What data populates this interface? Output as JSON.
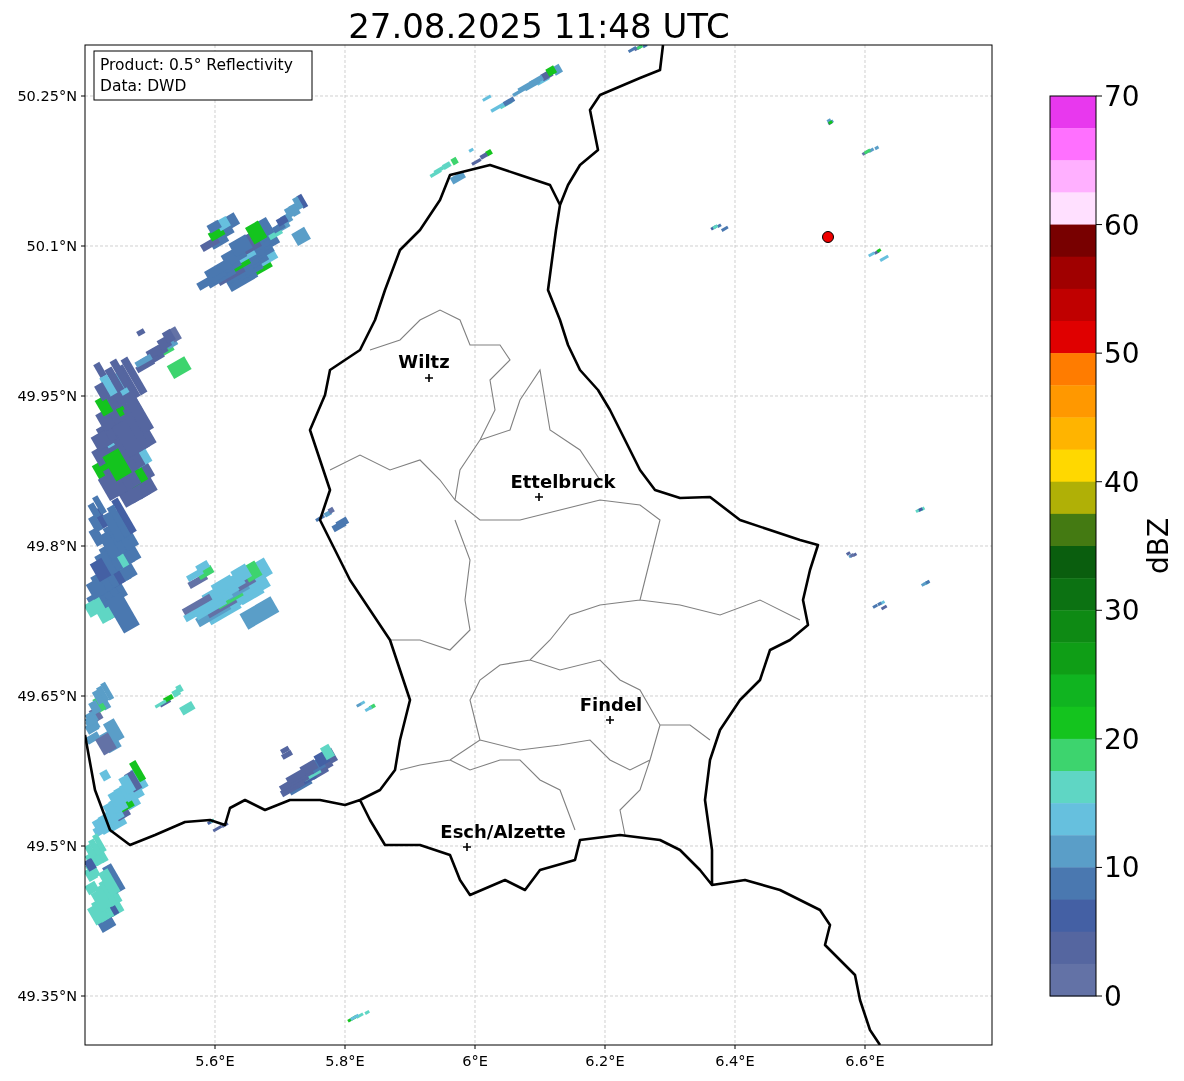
{
  "title": "27.08.2025 11:48 UTC",
  "info_box": {
    "lines": [
      "Product: 0.5° Reflectivity",
      "Data: DWD"
    ]
  },
  "map": {
    "yticks": [
      "50.25°N",
      "50.1°N",
      "49.95°N",
      "49.8°N",
      "49.65°N",
      "49.5°N",
      "49.35°N"
    ],
    "xticks": [
      "5.6°E",
      "5.8°E",
      "6°E",
      "6.2°E",
      "6.4°E",
      "6.6°E"
    ],
    "cities": [
      {
        "name": "Wiltz"
      },
      {
        "name": "Ettelbruck"
      },
      {
        "name": "Findel"
      },
      {
        "name": "Esch/Alzette"
      }
    ]
  },
  "colorbar": {
    "label": "dBZ",
    "ticks": [
      "70",
      "60",
      "50",
      "40",
      "30",
      "20",
      "10",
      "0"
    ],
    "segments": [
      {
        "color": "#e838ee"
      },
      {
        "color": "#ff70ff"
      },
      {
        "color": "#ffb0ff"
      },
      {
        "color": "#ffe0ff"
      },
      {
        "color": "#780000"
      },
      {
        "color": "#a00000"
      },
      {
        "color": "#c00000"
      },
      {
        "color": "#e00000"
      },
      {
        "color": "#ff7c00"
      },
      {
        "color": "#ff9800"
      },
      {
        "color": "#ffb400"
      },
      {
        "color": "#ffd800"
      },
      {
        "color": "#b0b006"
      },
      {
        "color": "#447a12"
      },
      {
        "color": "#0a5e0e"
      },
      {
        "color": "#0c7212"
      },
      {
        "color": "#0e8a14"
      },
      {
        "color": "#0f9e16"
      },
      {
        "color": "#10b420"
      },
      {
        "color": "#14c41e"
      },
      {
        "color": "#3dd46e"
      },
      {
        "color": "#5fd6c4"
      },
      {
        "color": "#66c0de"
      },
      {
        "color": "#5a9ec8"
      },
      {
        "color": "#4a78b0"
      },
      {
        "color": "#4460a4"
      },
      {
        "color": "#5566a0"
      },
      {
        "color": "#6372a6"
      }
    ]
  }
}
